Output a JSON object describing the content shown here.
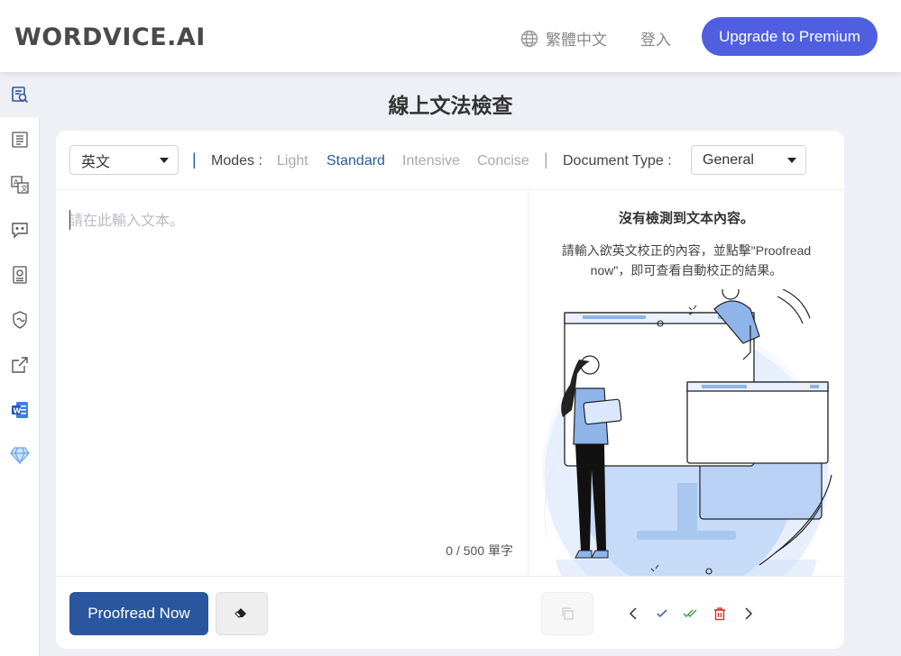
{
  "header": {
    "logo": "WORDVICE.AI",
    "language": "繁體中文",
    "login": "登入",
    "upgrade": "Upgrade to Premium"
  },
  "sidebar": {
    "items": [
      {
        "icon": "grammar-check-icon",
        "active": true
      },
      {
        "icon": "paraphrase-icon"
      },
      {
        "icon": "translate-icon"
      },
      {
        "icon": "chat-icon"
      },
      {
        "icon": "summary-icon"
      },
      {
        "icon": "ai-detector-icon"
      },
      {
        "icon": "external-link-icon"
      },
      {
        "icon": "word-addin-icon"
      },
      {
        "icon": "premium-diamond-icon"
      }
    ]
  },
  "page": {
    "title": "線上文法檢查"
  },
  "toolbar": {
    "language_select": "英文",
    "modes_label": "Modes :",
    "modes": [
      "Light",
      "Standard",
      "Intensive",
      "Concise"
    ],
    "active_mode": "Standard",
    "doctype_label": "Document Type :",
    "doctype_select": "General"
  },
  "editor": {
    "placeholder": "請在此輸入文本。",
    "word_count": "0 / 500 單字"
  },
  "result": {
    "empty_title": "沒有檢測到文本內容。",
    "empty_desc": "請輸入欲英文校正的內容，並點擊\"Proofread now\"，即可查看自動校正的結果。"
  },
  "actions": {
    "proofread": "Proofread Now"
  },
  "colors": {
    "accent": "#4f5fe0",
    "primary": "#2a56a0",
    "illustration_blue": "#8fb4ea"
  }
}
